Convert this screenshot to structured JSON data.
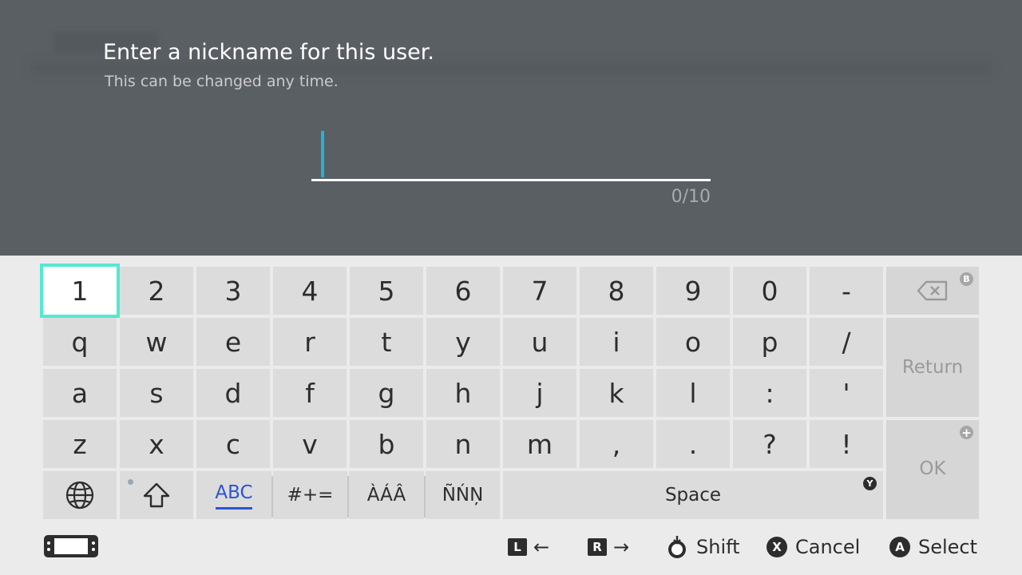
{
  "header": {
    "title": "Enter a nickname for this user.",
    "subtitle": "This can be changed any time.",
    "input_value": "",
    "counter": "0/10"
  },
  "keyboard": {
    "row1": [
      "1",
      "2",
      "3",
      "4",
      "5",
      "6",
      "7",
      "8",
      "9",
      "0",
      "-"
    ],
    "row2": [
      "q",
      "w",
      "e",
      "r",
      "t",
      "y",
      "u",
      "i",
      "o",
      "p",
      "/"
    ],
    "row3": [
      "a",
      "s",
      "d",
      "f",
      "g",
      "h",
      "j",
      "k",
      "l",
      ":",
      "'"
    ],
    "row4": [
      "z",
      "x",
      "c",
      "v",
      "b",
      "n",
      "m",
      ",",
      ".",
      "?",
      "!"
    ],
    "modes": {
      "abc": "ABC",
      "symbols": "#+=",
      "accent_a": "ÀÁÂ",
      "accent_n": "ÑŃŅ"
    },
    "space_label": "Space",
    "return_label": "Return",
    "ok_label": "OK",
    "badges": {
      "backspace": "B",
      "ok": "+",
      "space": "Y"
    }
  },
  "footer": {
    "l_button": "L",
    "r_button": "R",
    "shift_label": "Shift",
    "x_button": "X",
    "cancel_label": "Cancel",
    "a_button": "A",
    "select_label": "Select"
  },
  "colors": {
    "top_background": "#5a5f63",
    "caret": "#1fb4d8",
    "selection_border": "#55e8d2",
    "abc_accent": "#2a54d6"
  }
}
